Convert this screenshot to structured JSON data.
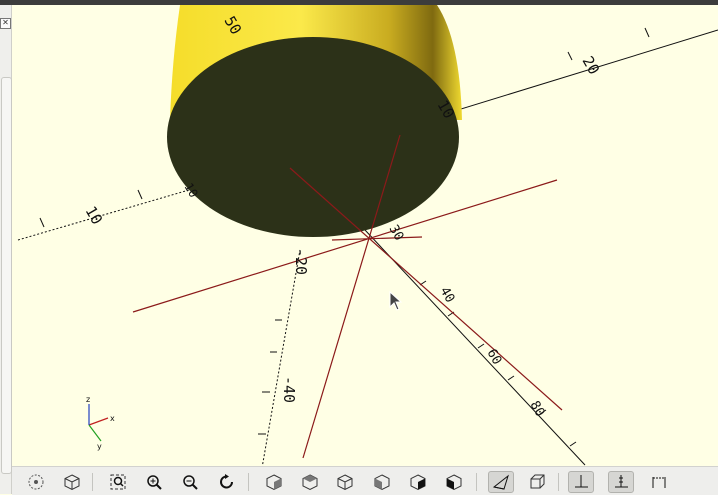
{
  "window": {
    "title": ""
  },
  "viewport": {
    "background": "#ffffe5",
    "object_color": "#f8e232",
    "cap_color": "#2c3118",
    "axis_color": "#8b1a1a",
    "tick_labels": {
      "top_50": "50",
      "upper_right_10": "10",
      "left_10": "10",
      "upper_left_10": "10",
      "center_30": "30",
      "mid_neg20": "-20",
      "lower_neg40": "-40",
      "right_20": "20",
      "lower_right_40": "40",
      "bottom_right_60": "60",
      "bottom_right_80": "80"
    },
    "axis_indicator": {
      "x": "x",
      "y": "y",
      "z": "z"
    }
  },
  "toolbar": {
    "icons": [
      "perspective-sphere-icon",
      "cube-icon",
      "zoom-all-icon",
      "zoom-in-icon",
      "zoom-out-icon",
      "reset-view-icon",
      "view-right-icon",
      "view-top-icon",
      "view-bottom-icon",
      "view-left-icon",
      "view-front-icon",
      "view-back-icon",
      "perspective-icon",
      "orthogonal-icon",
      "show-axes-icon",
      "show-scale-icon",
      "show-edges-icon"
    ]
  }
}
